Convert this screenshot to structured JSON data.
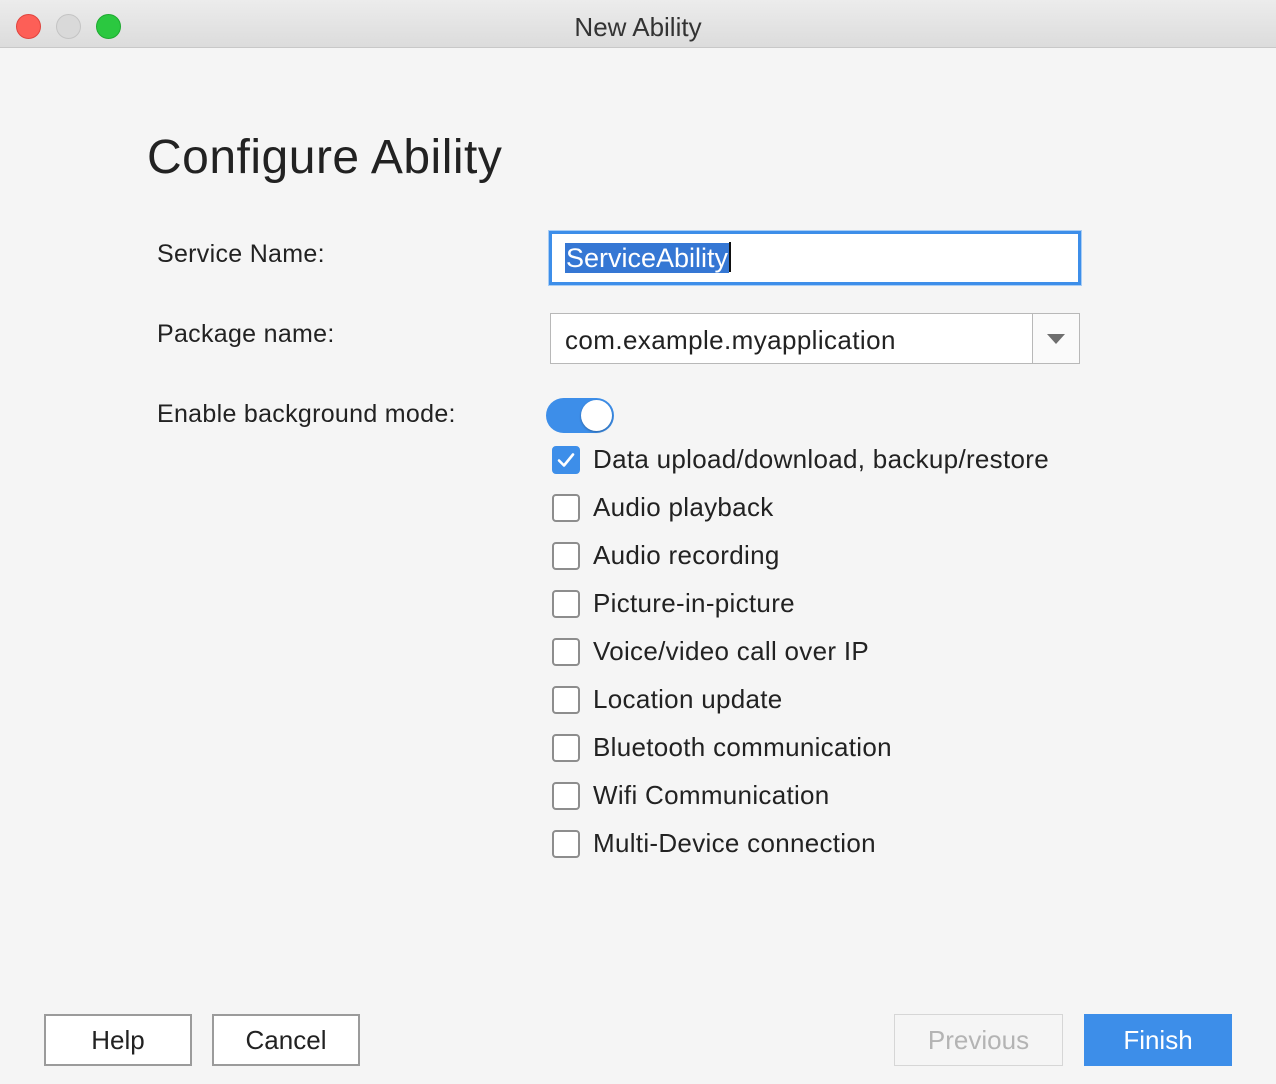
{
  "window": {
    "title": "New Ability"
  },
  "page": {
    "title": "Configure Ability"
  },
  "form": {
    "service_name_label": "Service Name:",
    "service_name_value": "ServiceAbility",
    "package_name_label": "Package name:",
    "package_name_value": "com.example.myapplication",
    "background_mode_label": "Enable background mode:",
    "background_mode_enabled": true
  },
  "background_modes": [
    {
      "label": "Data upload/download, backup/restore",
      "checked": true
    },
    {
      "label": "Audio playback",
      "checked": false
    },
    {
      "label": "Audio recording",
      "checked": false
    },
    {
      "label": "Picture-in-picture",
      "checked": false
    },
    {
      "label": "Voice/video call over IP",
      "checked": false
    },
    {
      "label": "Location update",
      "checked": false
    },
    {
      "label": "Bluetooth communication",
      "checked": false
    },
    {
      "label": "Wifi Communication",
      "checked": false
    },
    {
      "label": "Multi-Device connection",
      "checked": false
    }
  ],
  "buttons": {
    "help": "Help",
    "cancel": "Cancel",
    "previous": "Previous",
    "finish": "Finish"
  },
  "colors": {
    "accent": "#3d8ee9",
    "window_bg": "#f5f5f5",
    "close": "#fd5f57",
    "maximize": "#2bc840"
  }
}
